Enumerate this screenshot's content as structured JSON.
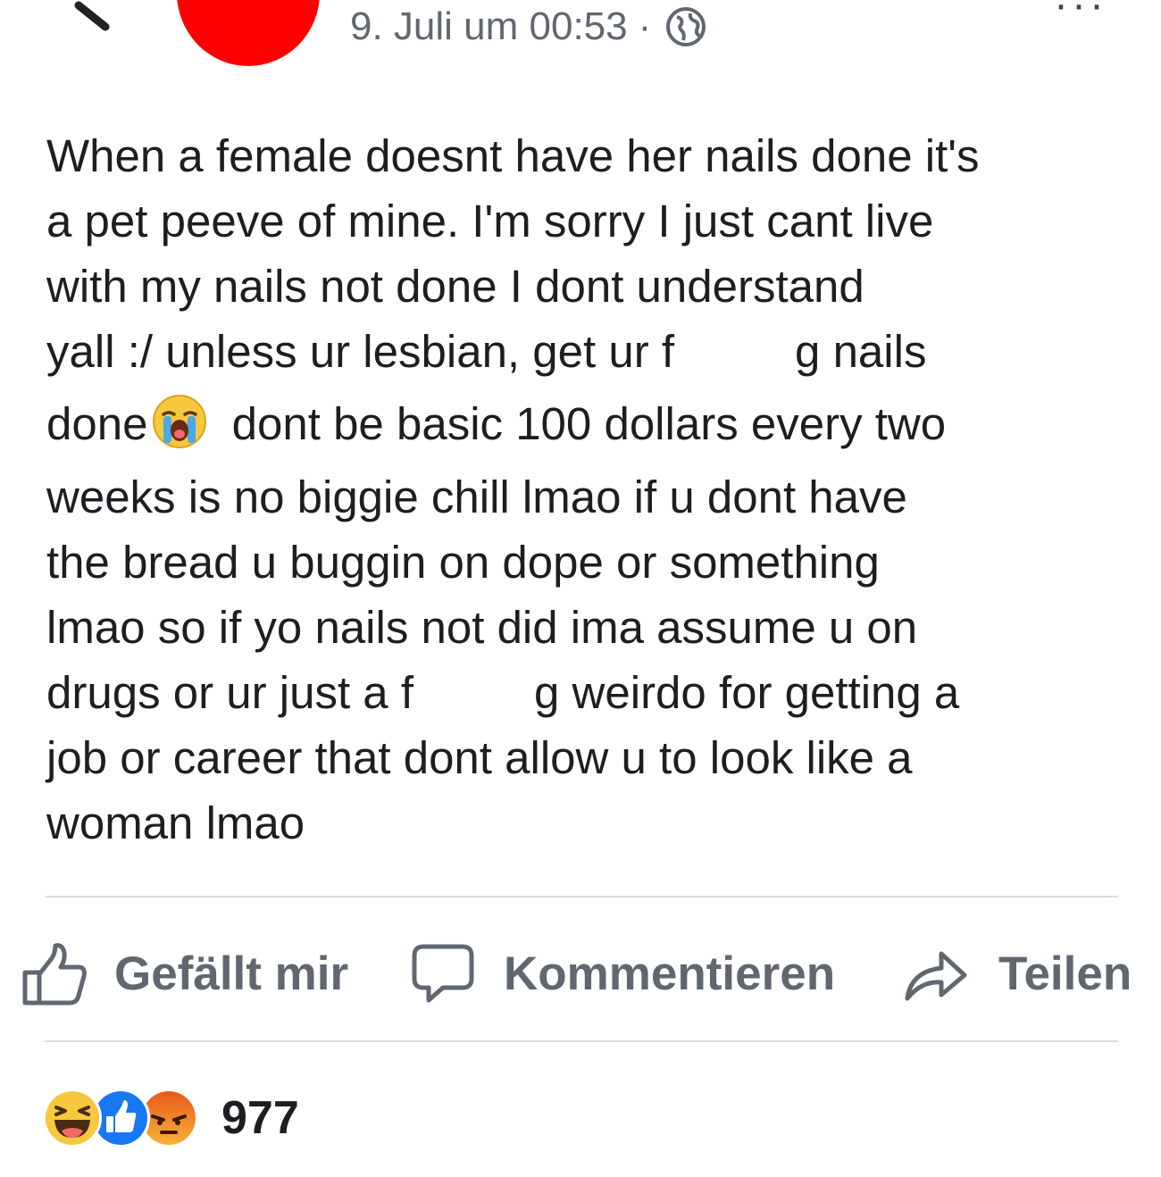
{
  "header": {
    "timestamp": "9. Juli um 00:53",
    "separator": "·",
    "privacy_icon": "globe-icon",
    "avatar_color": "#ff0000"
  },
  "post": {
    "lines": [
      {
        "before": "When a female doesnt have her nails done it's"
      },
      {
        "before": "a pet peeve of mine. I'm sorry I just cant live"
      },
      {
        "before": "with my nails not done I dont understand"
      },
      {
        "before": "yall :/ unless ur lesbian, get ur f",
        "after": "g nails",
        "censored": true
      },
      {
        "before": "done",
        "after": " dont be basic 100 dollars every two",
        "emoji": "loudly-crying-face"
      },
      {
        "before": "weeks is no biggie chill lmao if u dont have"
      },
      {
        "before": "the bread u buggin on dope or something"
      },
      {
        "before": "lmao so if yo nails not did ima assume u on"
      },
      {
        "before": "drugs or ur just a f",
        "after": "g weirdo for getting a",
        "censored": true
      },
      {
        "before": "job or career that dont allow u to look like a"
      },
      {
        "before": "woman lmao"
      }
    ]
  },
  "actions": {
    "like_label": "Gefällt mir",
    "comment_label": "Kommentieren",
    "share_label": "Teilen",
    "icon_color": "#606770"
  },
  "reactions": {
    "icons": [
      "haha-icon",
      "like-reaction-icon",
      "angry-icon"
    ],
    "count": "977"
  }
}
